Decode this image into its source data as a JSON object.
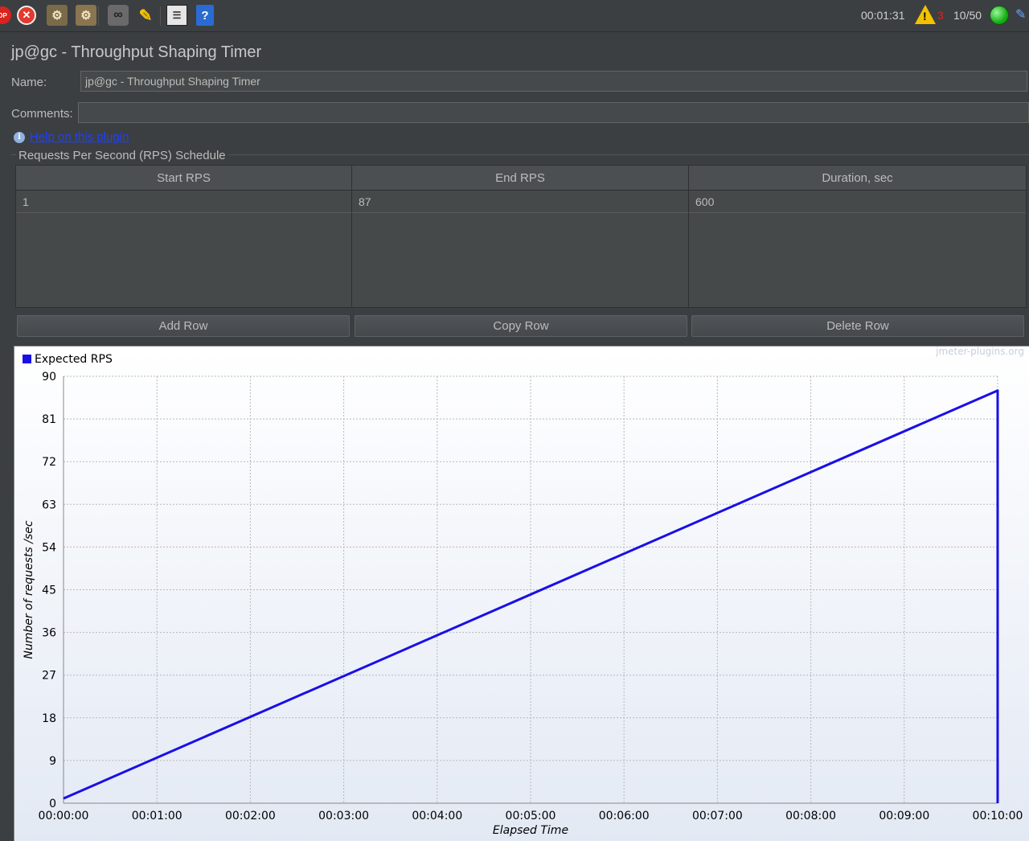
{
  "toolbar": {
    "icons": [
      "stop-icon",
      "shutdown-icon",
      "clear-icon",
      "clear-all-icon",
      "search-icon",
      "reset-search-icon",
      "function-helper-icon",
      "help-icon",
      "warning-icon",
      "running-indicator-icon",
      "log-viewer-icon"
    ],
    "stop_glyph": "OP",
    "elapsed": "00:01:31",
    "error_count": "3",
    "threads": "10/50"
  },
  "panel": {
    "title": "jp@gc - Throughput Shaping Timer",
    "name_label": "Name:",
    "name_value": "jp@gc - Throughput Shaping Timer",
    "comments_label": "Comments:",
    "comments_value": "",
    "help_link": "Help on this plugin",
    "schedule_title": "Requests Per Second (RPS) Schedule"
  },
  "table": {
    "headers": [
      "Start RPS",
      "End RPS",
      "Duration, sec"
    ],
    "rows": [
      [
        "1",
        "87",
        "600"
      ]
    ]
  },
  "buttons": {
    "add_row": "Add Row",
    "copy_row": "Copy Row",
    "delete_row": "Delete Row"
  },
  "chart_data": {
    "type": "line",
    "watermark": "jmeter-plugins.org",
    "xlabel": "Elapsed Time",
    "ylabel": "Number of requests /sec",
    "ylim": [
      0,
      90
    ],
    "yticks": [
      0,
      9,
      18,
      27,
      36,
      45,
      54,
      63,
      72,
      81,
      90
    ],
    "xlim": [
      "00:00:00",
      "00:10:00"
    ],
    "xticks": [
      "00:00:00",
      "00:01:00",
      "00:02:00",
      "00:03:00",
      "00:04:00",
      "00:05:00",
      "00:06:00",
      "00:07:00",
      "00:08:00",
      "00:09:00",
      "00:10:00"
    ],
    "grid": true,
    "legend": "top-left",
    "series": [
      {
        "name": "Expected RPS",
        "color": "#1a0fe6",
        "x": [
          "00:00:00",
          "00:10:00",
          "00:10:00"
        ],
        "y": [
          1,
          87,
          0
        ]
      }
    ]
  }
}
